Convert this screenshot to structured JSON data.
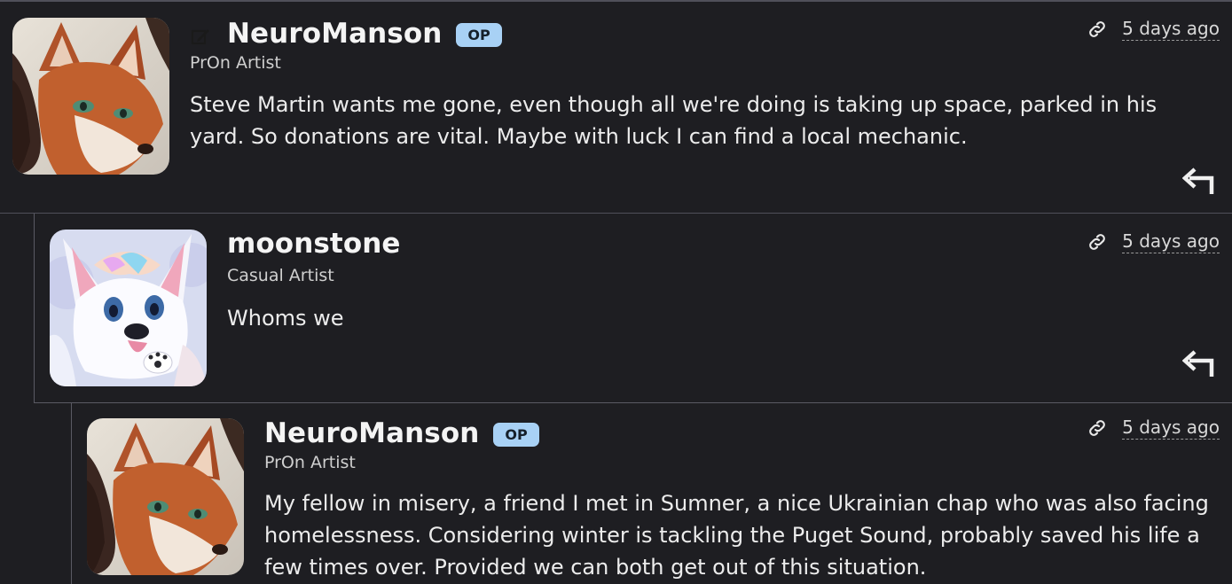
{
  "comments": [
    {
      "username": "NeuroManson",
      "badge": "OP",
      "title": "PrOn Artist",
      "timestamp": "5 days ago",
      "body": "Steve Martin wants me gone, even though all we're doing is taking up space, parked in his yard. So donations are vital. Maybe with luck I can find a local mechanic.",
      "icons": {
        "edit": "edit-icon",
        "link": "link-icon",
        "reply": "reply-icon",
        "avatar": "fox-avatar"
      }
    },
    {
      "username": "moonstone",
      "title": "Casual Artist",
      "timestamp": "5 days ago",
      "body": "Whoms we",
      "icons": {
        "link": "link-icon",
        "reply": "reply-icon",
        "avatar": "white-fox-avatar"
      }
    },
    {
      "username": "NeuroManson",
      "badge": "OP",
      "title": "PrOn Artist",
      "timestamp": "5 days ago",
      "body": "My fellow in misery, a friend I met in Sumner, a nice Ukrainian chap who was also facing homelessness. Considering winter is tackling the Puget Sound, probably saved his life a few times over. Provided we can both get out of this situation.",
      "icons": {
        "link": "link-icon",
        "avatar": "fox-avatar"
      }
    }
  ],
  "colors": {
    "background": "#1e1e22",
    "border": "#50505a",
    "op_badge": "#a8d1f5",
    "text": "#ececec"
  }
}
